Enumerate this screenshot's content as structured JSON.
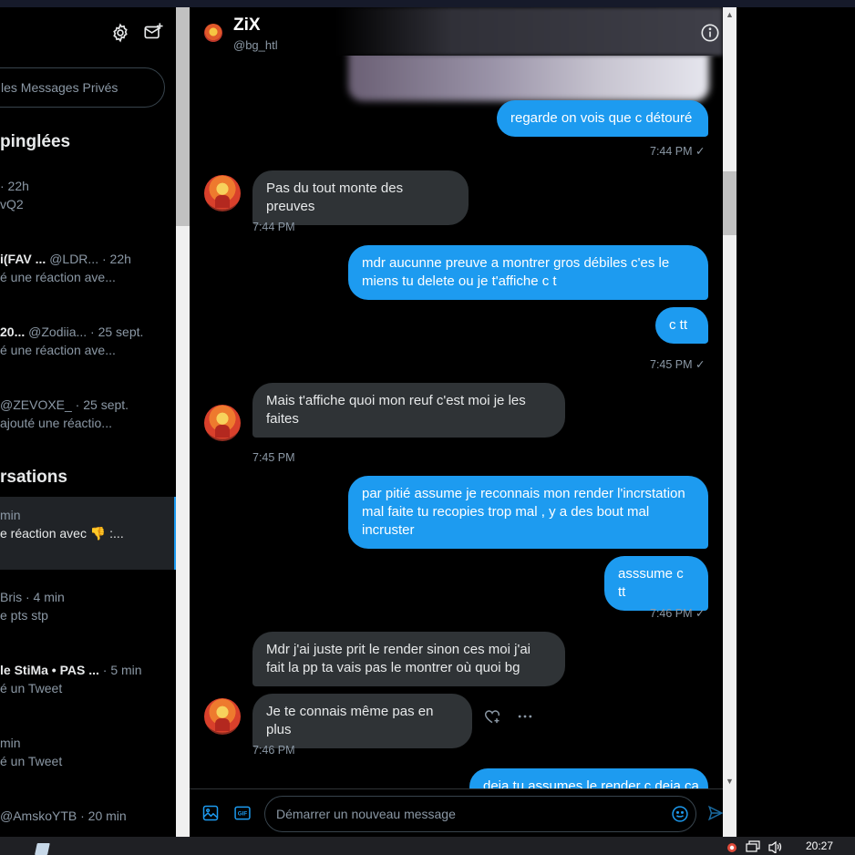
{
  "sidebar": {
    "search_placeholder": "les Messages Privés",
    "pinned_title": "pinglées",
    "conversations_title": "rsations",
    "pinned": [
      {
        "name": "",
        "meta": "· 22h",
        "preview": "vQ2"
      },
      {
        "name": "i(FAV ...",
        "meta": "@LDR...  · 22h",
        "preview": "é une réaction ave..."
      },
      {
        "name": "20...",
        "meta": "@Zodiia...  · 25 sept.",
        "preview": "é une réaction ave..."
      },
      {
        "name": "",
        "meta": "@ZEVOXE_ · 25 sept.",
        "preview": "ajouté une réactio..."
      }
    ],
    "conversations": [
      {
        "name": "",
        "meta": "min",
        "preview": "e réaction avec 👎 :..."
      },
      {
        "name": "",
        "meta": "Bris · 4 min",
        "preview": "e pts stp"
      },
      {
        "name": "le StiMa • PAS ...",
        "meta": "· 5 min",
        "preview": "é un Tweet"
      },
      {
        "name": "",
        "meta": "min",
        "preview": "é un Tweet"
      },
      {
        "name": "",
        "meta": "@AmskoYTB · 20 min",
        "preview": ""
      }
    ]
  },
  "chat": {
    "header": {
      "name": "ZiX",
      "handle": "@bg_htl"
    },
    "messages": [
      {
        "dir": "out",
        "text": "regarde on vois que c détouré",
        "time": "7:44 PM",
        "check": "✓"
      },
      {
        "dir": "in",
        "text": "Pas du tout monte des preuves",
        "time": "7:44 PM"
      },
      {
        "dir": "out",
        "text": "mdr aucunne preuve a montrer gros débiles c'es le\nmiens tu delete ou je t'affiche c t"
      },
      {
        "dir": "out",
        "text": "c  tt",
        "time": "7:45 PM",
        "check": "✓"
      },
      {
        "dir": "in",
        "text": "Mais t'affiche quoi mon reuf c'est moi je les\nfaites",
        "time": "7:45 PM"
      },
      {
        "dir": "out",
        "text": "par pitié assume je reconnais mon render l'incrstation\nmal faite tu recopies trop mal , y a des bout mal\nincruster"
      },
      {
        "dir": "out",
        "text": "asssume c tt",
        "time": "7:46 PM",
        "check": "✓"
      },
      {
        "dir": "in",
        "text": "Mdr j'ai juste prit le render sinon ces moi j'ai\nfait la pp ta vais pas le montrer où quoi bg"
      },
      {
        "dir": "in",
        "text": "Je te connais même pas en plus",
        "time": "7:46 PM"
      },
      {
        "dir": "out",
        "text": "deja tu assumes le render c deja ça"
      }
    ],
    "composer": {
      "placeholder": "Démarrer un nouveau message",
      "gif_label": "GIF"
    }
  },
  "taskbar": {
    "clock": "20:27"
  },
  "colors": {
    "accent": "#1d9bf0",
    "bubble_in": "#2f3336",
    "background": "#000000"
  },
  "icons": [
    "gear-icon",
    "new-message-icon",
    "info-icon",
    "image-icon",
    "gif-icon",
    "emoji-icon",
    "send-icon",
    "heart-plus-icon",
    "more-icon"
  ]
}
